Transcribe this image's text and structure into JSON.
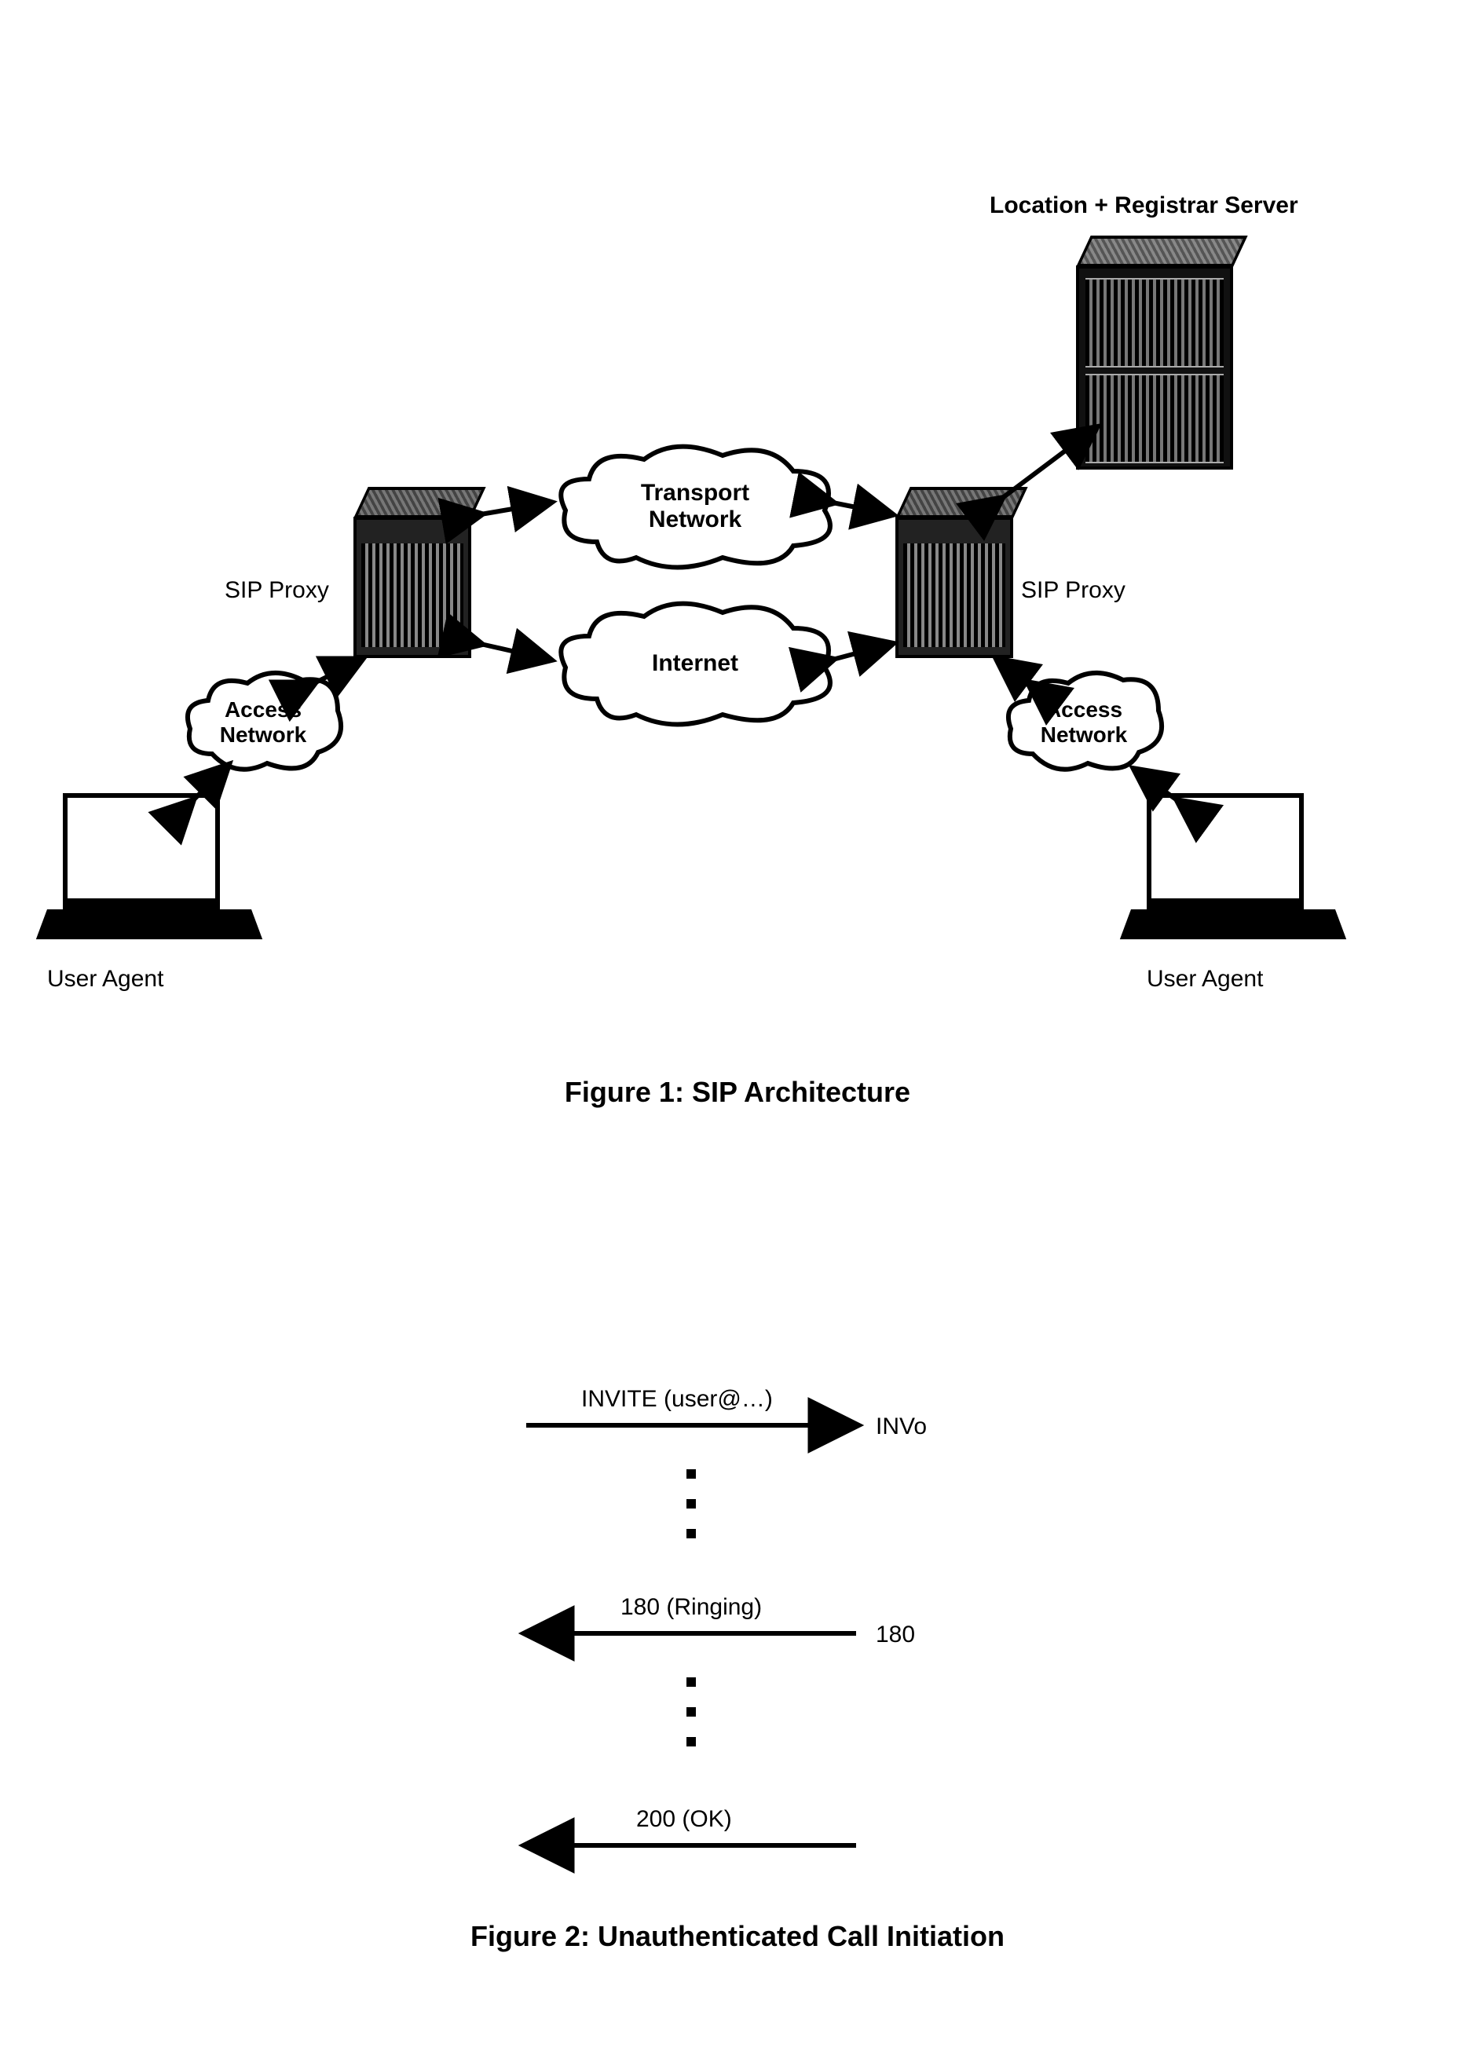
{
  "fig1": {
    "caption_prefix": "Figure 1:",
    "caption_title": "SIP Architecture",
    "labels": {
      "user_agent_left": "User Agent",
      "user_agent_right": "User Agent",
      "sip_proxy_left": "SIP Proxy",
      "sip_proxy_right": "SIP Proxy",
      "registrar": "Location + Registrar Server",
      "access_network_left": "Access Network",
      "access_network_right": "Access Network",
      "transport_network": "Transport Network",
      "internet": "Internet"
    }
  },
  "fig2": {
    "caption_prefix": "Figure 2:",
    "caption_title": "Unauthenticated Call Initiation",
    "messages": [
      {
        "text": "INVITE (user@…)",
        "side_label": "INVo",
        "direction": "right"
      },
      {
        "text": "180 (Ringing)",
        "side_label": "180",
        "direction": "left"
      },
      {
        "text": "200 (OK)",
        "side_label": "",
        "direction": "left"
      }
    ]
  }
}
